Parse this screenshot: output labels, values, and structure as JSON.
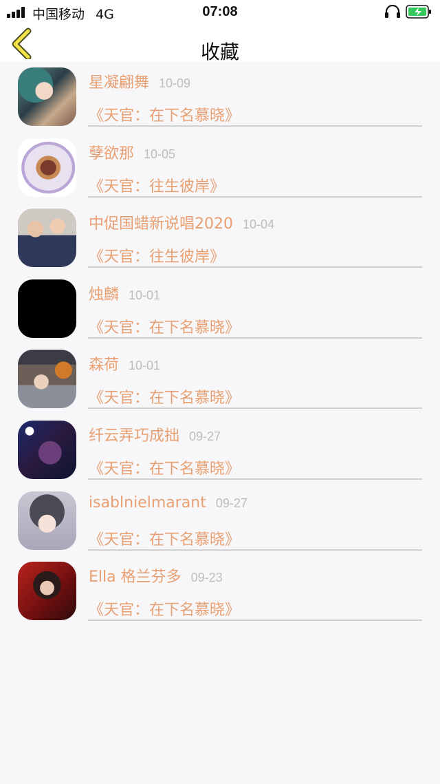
{
  "status": {
    "carrier": "中国移动",
    "network": "4G",
    "time": "07:08"
  },
  "header": {
    "title": "收藏"
  },
  "colors": {
    "accent": "#e8a073",
    "date": "#bdbdbd",
    "divider": "#cfcfcf",
    "battery": "#35c759"
  },
  "favorites": [
    {
      "name": "星凝翩舞",
      "date": "10-09",
      "book": "《天官：在下名慕晓》",
      "avatar": "anime-girl-teal-hair"
    },
    {
      "name": "孽欲那",
      "date": "10-05",
      "book": "《天官：往生彼岸》",
      "avatar": "food-plate"
    },
    {
      "name": "中促国蜡新说唱2020",
      "date": "10-04",
      "book": "《天官：往生彼岸》",
      "avatar": "couple-photo"
    },
    {
      "name": "烛麟",
      "date": "10-01",
      "book": "《天官：在下名慕晓》",
      "avatar": "black-square"
    },
    {
      "name": "森荷",
      "date": "10-01",
      "book": "《天官：在下名慕晓》",
      "avatar": "girl-photo-halloween"
    },
    {
      "name": "纤云弄巧成拙",
      "date": "09-27",
      "book": "《天官：在下名慕晓》",
      "avatar": "anime-dark-starry"
    },
    {
      "name": "isablnielmarant",
      "date": "09-27",
      "book": "《天官：在下名慕晓》",
      "avatar": "anime-girl-animal-hood"
    },
    {
      "name": "Ella 格兰芬多",
      "date": "09-23",
      "book": "《天官：在下名慕晓》",
      "avatar": "anime-girl-red-background"
    }
  ]
}
